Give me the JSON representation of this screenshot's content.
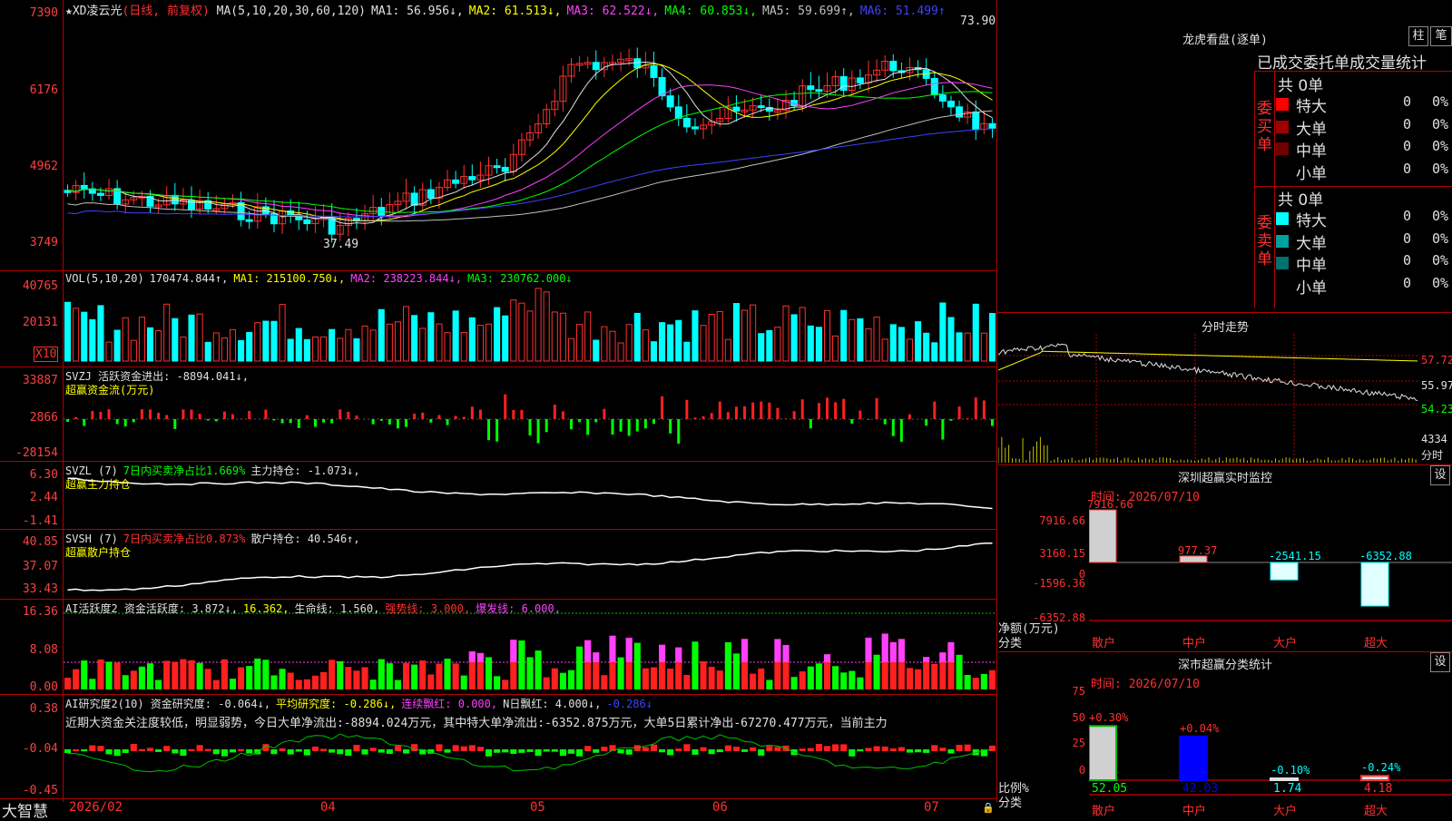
{
  "app": {
    "logo": "大智慧"
  },
  "stock": {
    "title": "★XD凌云光",
    "period": "(日线, 前复权)"
  },
  "main_chart": {
    "ma_labels": [
      {
        "text": "MA(5,10,20,30,60,120)",
        "color": "#e0e0e0"
      },
      {
        "text": "MA1: 56.956↓,",
        "color": "#e0e0e0"
      },
      {
        "text": "MA2: 61.513↓,",
        "color": "#ffff00"
      },
      {
        "text": "MA3: 62.522↓,",
        "color": "#ff40ff"
      },
      {
        "text": "MA4: 60.853↓,",
        "color": "#00ff00"
      },
      {
        "text": "MA5: 59.699↑,",
        "color": "#c0c0c0"
      },
      {
        "text": "MA6: 51.499↑",
        "color": "#4040ff"
      }
    ],
    "y_ticks": [
      "7390",
      "6176",
      "4962",
      "3749"
    ],
    "high_mark": "73.90",
    "low_mark": "37.49"
  },
  "vol_pane": {
    "labels": [
      {
        "text": "VOL(5,10,20)",
        "color": "#e0e0e0"
      },
      {
        "text": "170474.844↑,",
        "color": "#e0e0e0"
      },
      {
        "text": "MA1: 215100.750↓,",
        "color": "#ffff00"
      },
      {
        "text": "MA2: 238223.844↓,",
        "color": "#ff40ff"
      },
      {
        "text": "MA3: 230762.000↓",
        "color": "#00ff00"
      }
    ],
    "y_ticks": [
      "40765",
      "20131"
    ],
    "unit": "X10"
  },
  "svzj_pane": {
    "labels": [
      {
        "text": "SVZJ  活跃资金进出: -8894.041↓,",
        "color": "#e0e0e0"
      }
    ],
    "sub": "超赢资金流(万元)",
    "y_ticks": [
      "33887",
      "2866",
      "-28154"
    ]
  },
  "svzl_pane": {
    "labels": [
      {
        "text": "SVZL (7)",
        "color": "#e0e0e0"
      },
      {
        "text": "7日内买卖净占比1.669%",
        "color": "#00ff00"
      },
      {
        "text": "主力持仓: -1.073↓,",
        "color": "#e0e0e0"
      }
    ],
    "sub": "超赢主力持仓",
    "y_ticks": [
      "6.30",
      "2.44",
      "-1.41"
    ]
  },
  "svsh_pane": {
    "labels": [
      {
        "text": "SVSH (7)",
        "color": "#e0e0e0"
      },
      {
        "text": "7日内买卖净占比0.873%",
        "color": "#ff3030"
      },
      {
        "text": "散户持仓: 40.546↑,",
        "color": "#e0e0e0"
      }
    ],
    "sub": "超赢散户持仓",
    "y_ticks": [
      "40.85",
      "37.07",
      "33.43"
    ]
  },
  "ai_active": {
    "labels": [
      {
        "text": "AI活跃度2 资金活跃度: 3.872↓,",
        "color": "#e0e0e0"
      },
      {
        "text": "16.362,",
        "color": "#ffff00"
      },
      {
        "text": "生命线: 1.560,",
        "color": "#e0e0e0"
      },
      {
        "text": "强势线: 3.000,",
        "color": "#ff3030"
      },
      {
        "text": "爆发线: 6.000,",
        "color": "#ff40ff"
      }
    ],
    "y_ticks": [
      "16.36",
      "8.08",
      "0.00"
    ]
  },
  "ai_research": {
    "labels": [
      {
        "text": "AI研究度2(10) 资金研究度: -0.064↓,",
        "color": "#e0e0e0"
      },
      {
        "text": "平均研究度: -0.286↓,",
        "color": "#ffff00"
      },
      {
        "text": "连续飘红: 0.000,",
        "color": "#ff40ff"
      },
      {
        "text": "N日飘红: 4.000↓,",
        "color": "#e0e0e0"
      },
      {
        "text": "-0.286↓",
        "color": "#4040ff"
      }
    ],
    "commentary": "近期大资金关注度较低，明显弱势，今日大单净流出:-8894.024万元，其中特大单净流出:-6352.875万元，大单5日累计净出-67270.477万元，当前主力",
    "y_ticks": [
      "0.38",
      "-0.04",
      "-0.45"
    ]
  },
  "x_axis": {
    "labels": [
      "2026/02",
      "04",
      "05",
      "06",
      "07"
    ]
  },
  "right": {
    "lhb_title": "龙虎看盘(逐单)",
    "btn_bar": "柱",
    "btn_pen": "笔",
    "table_header": "已成交委托单成交量统计",
    "buy_label": "委买单",
    "sell_label": "委卖单",
    "buy_total": "共 0单",
    "sell_total": "共 0单",
    "buy_rows": [
      {
        "name": "特大",
        "count": "0",
        "pct": "0%",
        "color": "#ff0000"
      },
      {
        "name": "大单",
        "count": "0",
        "pct": "0%",
        "color": "#a00000"
      },
      {
        "name": "中单",
        "count": "0",
        "pct": "0%",
        "color": "#700000"
      },
      {
        "name": "小单",
        "count": "0",
        "pct": "0%",
        "color": "#000000"
      }
    ],
    "sell_rows": [
      {
        "name": "特大",
        "count": "0",
        "pct": "0%",
        "color": "#00ffff"
      },
      {
        "name": "大单",
        "count": "0",
        "pct": "0%",
        "color": "#00a0a0"
      },
      {
        "name": "中单",
        "count": "0",
        "pct": "0%",
        "color": "#007070"
      },
      {
        "name": "小单",
        "count": "0",
        "pct": "0%",
        "color": "#000000"
      }
    ],
    "intraday_title": "分时走势",
    "intraday_ticks": [
      "57.72",
      "55.97",
      "54.23"
    ],
    "intraday_vol": "4334",
    "intraday_vol_unit": "分时",
    "sz_title": "深圳超赢实时监控",
    "sz_btn": "设",
    "sz_time": "时间: 2026/07/10",
    "sz_ticks": [
      "7916.66",
      "3160.15",
      "0",
      "-1596.36",
      "-6352.88"
    ],
    "sz_unit": "净额(万元)",
    "sz_cat_label": "分类",
    "sz_cats": [
      "散户",
      "中户",
      "大户",
      "超大"
    ],
    "sz_values": [
      "7916.66",
      "977.37",
      "-2541.15",
      "-6352.88"
    ],
    "ss_title": "深市超赢分类统计",
    "ss_btn": "设",
    "ss_time": "时间: 2026/07/10",
    "ss_ticks": [
      "75",
      "50",
      "25",
      "0"
    ],
    "ss_unit": "比例%",
    "ss_cat_label": "分类",
    "ss_cats": [
      "散户",
      "中户",
      "大户",
      "超大"
    ],
    "ss_changes": [
      "+0.30%",
      "+0.04%",
      "-0.10%",
      "-0.24%"
    ],
    "ss_values": [
      "52.05",
      "42.03",
      "1.74",
      "4.18"
    ]
  }
}
